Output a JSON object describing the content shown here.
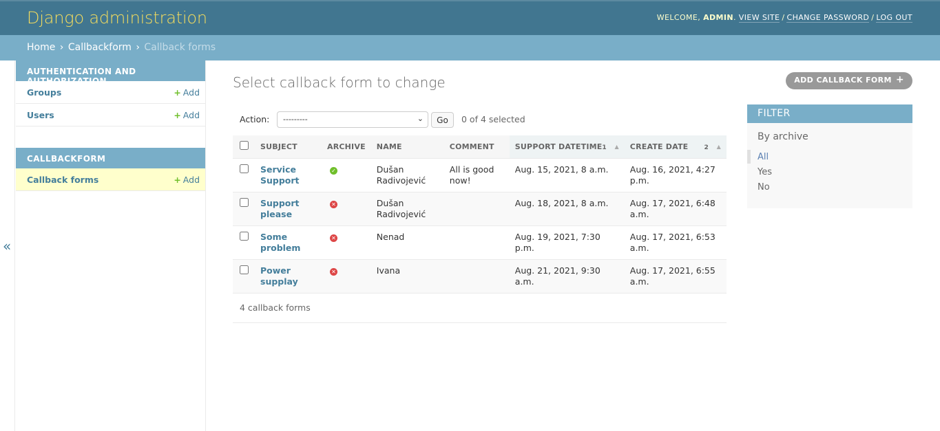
{
  "header": {
    "site_name": "Django administration",
    "welcome_prefix": "Welcome,",
    "username": "admin",
    "view_site": "View site",
    "change_password": "Change password",
    "log_out": "Log out"
  },
  "breadcrumbs": {
    "home": "Home",
    "app": "Callbackform",
    "current": "Callback forms"
  },
  "sidebar": {
    "toggle_label": "«",
    "modules": [
      {
        "caption": "Authentication and Authorization",
        "models": [
          {
            "name": "Groups",
            "add": "Add"
          },
          {
            "name": "Users",
            "add": "Add"
          }
        ]
      },
      {
        "caption": "Callbackform",
        "models": [
          {
            "name": "Callback forms",
            "add": "Add"
          }
        ]
      }
    ]
  },
  "main": {
    "title": "Select callback form to change",
    "add_button": "Add callback form",
    "actions": {
      "label": "Action:",
      "selected_option": "---------",
      "go_label": "Go",
      "counter": "0 of 4 selected"
    },
    "table": {
      "headers": {
        "subject": "Subject",
        "archive": "Archive",
        "name": "Name",
        "comment": "Comment",
        "support_datetime": "Support datetime",
        "support_datetime_priority": "1",
        "create_date": "Create date",
        "create_date_priority": "2"
      },
      "rows": [
        {
          "subject": "Service Support",
          "archive": true,
          "name": "Dušan Radivojević",
          "comment": "All is good now!",
          "support_datetime": "Aug. 15, 2021, 8 a.m.",
          "create_date": "Aug. 16, 2021, 4:27 p.m."
        },
        {
          "subject": "Support please",
          "archive": false,
          "name": "Dušan Radivojević",
          "comment": "",
          "support_datetime": "Aug. 18, 2021, 8 a.m.",
          "create_date": "Aug. 17, 2021, 6:48 a.m."
        },
        {
          "subject": "Some problem",
          "archive": false,
          "name": "Nenad",
          "comment": "",
          "support_datetime": "Aug. 19, 2021, 7:30 p.m.",
          "create_date": "Aug. 17, 2021, 6:53 a.m."
        },
        {
          "subject": "Power supplay",
          "archive": false,
          "name": "Ivana",
          "comment": "",
          "support_datetime": "Aug. 21, 2021, 9:30 a.m.",
          "create_date": "Aug. 17, 2021, 6:55 a.m."
        }
      ]
    },
    "paginator": "4 callback forms"
  },
  "filter": {
    "title": "Filter",
    "heading": "By archive",
    "options": [
      "All",
      "Yes",
      "No"
    ],
    "selected": "All"
  },
  "colors": {
    "header_bg": "#417690",
    "breadcrumbs_bg": "#79aec8",
    "link": "#447e9b",
    "brand_yellow": "#f5dd5d",
    "add_green": "#70bf2b",
    "no_red": "#dd4646"
  }
}
